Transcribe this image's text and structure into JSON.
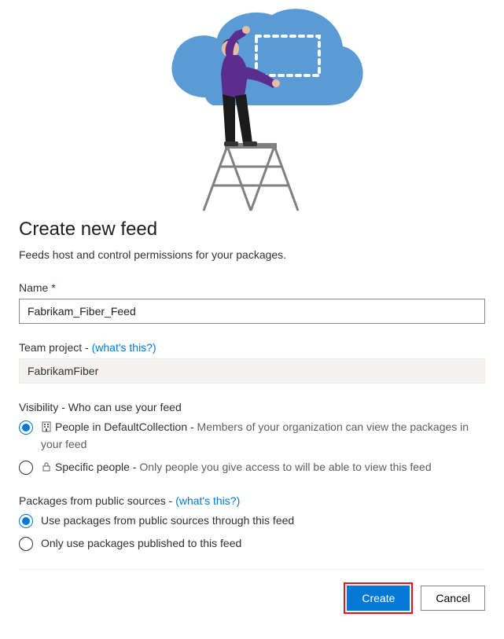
{
  "heading": "Create new feed",
  "subtitle": "Feeds host and control permissions for your packages.",
  "name_field": {
    "label": "Name",
    "required_mark": "*",
    "value": "Fabrikam_Fiber_Feed"
  },
  "team_project": {
    "label": "Team project - ",
    "help_link": "(what's this?)",
    "value": "FabrikamFiber"
  },
  "visibility": {
    "label": "Visibility - Who can use your feed",
    "options": [
      {
        "title": "People in DefaultCollection - ",
        "desc": "Members of your organization can view the packages in your feed",
        "icon": "organization-icon",
        "checked": true
      },
      {
        "title": "Specific people - ",
        "desc": "Only people you give access to will be able to view this feed",
        "icon": "lock-icon",
        "checked": false
      }
    ]
  },
  "public_sources": {
    "label": "Packages from public sources - ",
    "help_link": "(what's this?)",
    "options": [
      {
        "label": "Use packages from public sources through this feed",
        "checked": true
      },
      {
        "label": "Only use packages published to this feed",
        "checked": false
      }
    ]
  },
  "buttons": {
    "create": "Create",
    "cancel": "Cancel"
  }
}
